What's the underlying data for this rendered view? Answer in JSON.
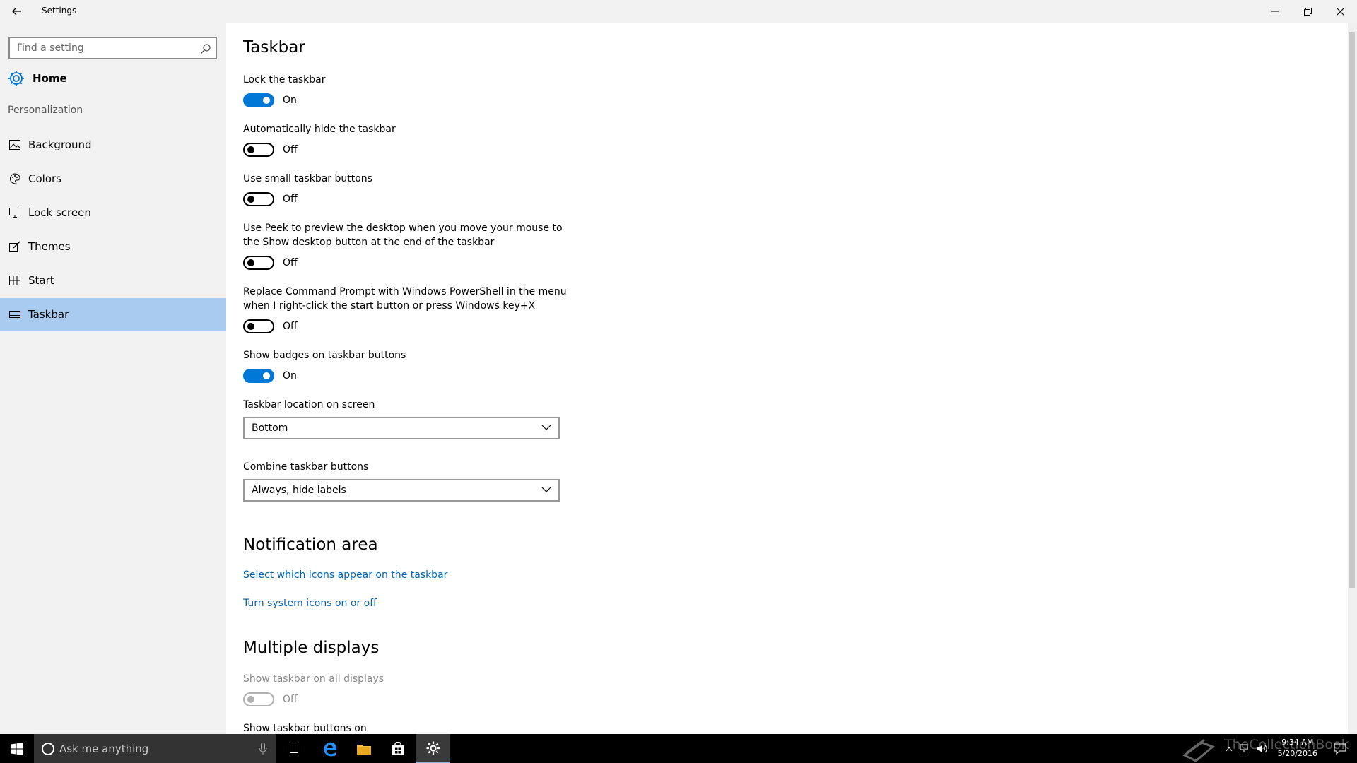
{
  "window": {
    "title": "Settings"
  },
  "sidebar": {
    "search_placeholder": "Find a setting",
    "home_label": "Home",
    "section_label": "Personalization",
    "items": [
      {
        "label": "Background",
        "icon": "picture-icon"
      },
      {
        "label": "Colors",
        "icon": "palette-icon"
      },
      {
        "label": "Lock screen",
        "icon": "monitor-icon"
      },
      {
        "label": "Themes",
        "icon": "brush-icon"
      },
      {
        "label": "Start",
        "icon": "start-grid-icon"
      },
      {
        "label": "Taskbar",
        "icon": "taskbar-icon",
        "active": true
      }
    ]
  },
  "main": {
    "title": "Taskbar",
    "settings": [
      {
        "label": "Lock the taskbar",
        "state": "On"
      },
      {
        "label": "Automatically hide the taskbar",
        "state": "Off"
      },
      {
        "label": "Use small taskbar buttons",
        "state": "Off"
      },
      {
        "label": "Use Peek to preview the desktop when you move your mouse to the Show desktop button at the end of the taskbar",
        "state": "Off"
      },
      {
        "label": "Replace Command Prompt with Windows PowerShell in the menu when I right-click the start button or press Windows key+X",
        "state": "Off"
      },
      {
        "label": "Show badges on taskbar buttons",
        "state": "On"
      }
    ],
    "location": {
      "label": "Taskbar location on screen",
      "value": "Bottom"
    },
    "combine": {
      "label": "Combine taskbar buttons",
      "value": "Always, hide labels"
    },
    "notification": {
      "title": "Notification area",
      "link1": "Select which icons appear on the taskbar",
      "link2": "Turn system icons on or off"
    },
    "multiple": {
      "title": "Multiple displays",
      "show_all_label": "Show taskbar on all displays",
      "show_all_state": "Off",
      "buttons_on_label": "Show taskbar buttons on"
    }
  },
  "taskbar": {
    "cortana_placeholder": "Ask me anything",
    "time": "9:34 AM",
    "date": "5/20/2016",
    "watermark": "TheCollectionBook"
  },
  "colors": {
    "accent": "#0078d7",
    "selected": "#a8cbef",
    "link": "#0063b1"
  }
}
